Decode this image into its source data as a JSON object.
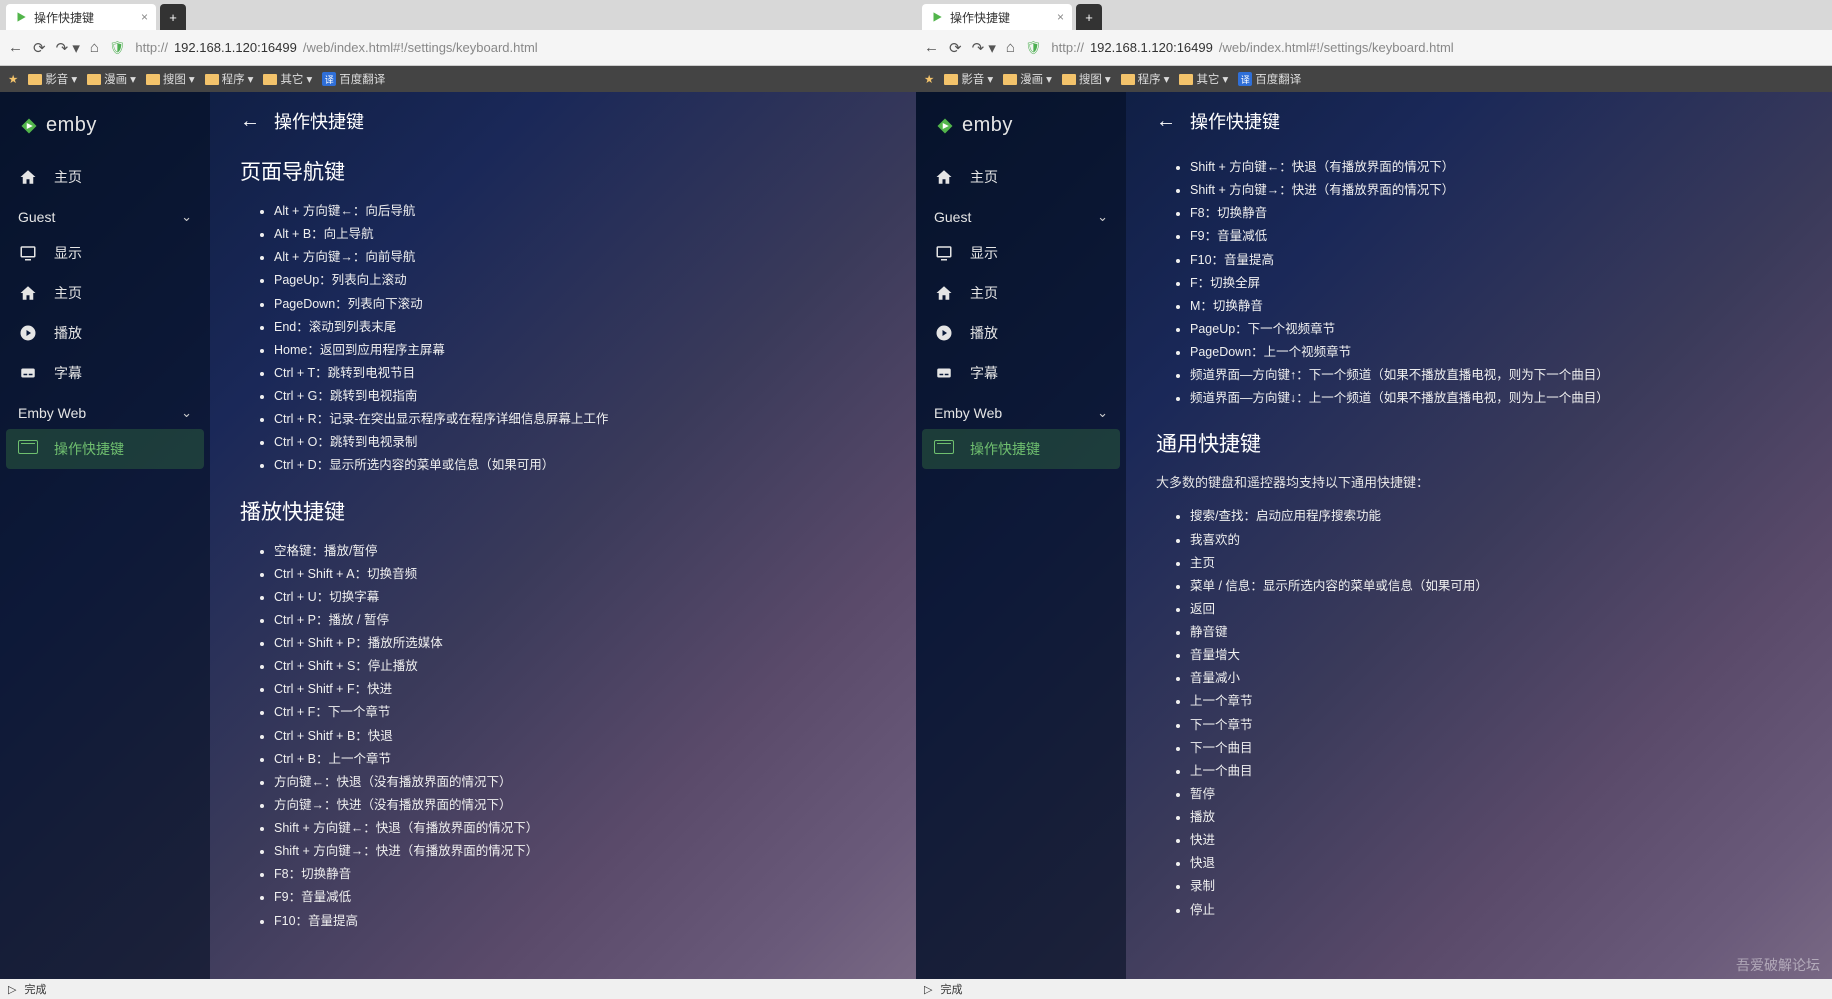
{
  "browser": {
    "tab_title": "操作快捷键",
    "url_prefix": "http://",
    "url_host": "192.168.1.120:16499",
    "url_path": "/web/index.html#!/settings/keyboard.html",
    "status": "完成"
  },
  "bookmarks": [
    "影音",
    "漫画",
    "搜图",
    "程序",
    "其它",
    "百度翻译"
  ],
  "logo_text": "emby",
  "sidebar": {
    "home": "主页",
    "guest": "Guest",
    "display": "显示",
    "home2": "主页",
    "play": "播放",
    "subtitle": "字幕",
    "web": "Emby Web",
    "shortcuts": "操作快捷键"
  },
  "page_title": "操作快捷键",
  "left": {
    "section1": {
      "title": "页面导航键",
      "items": [
        "Alt + 方向键←：向后导航",
        "Alt + B：向上导航",
        "Alt + 方向键→：向前导航",
        "PageUp：列表向上滚动",
        "PageDown：列表向下滚动",
        "End：滚动到列表末尾",
        "Home：返回到应用程序主屏幕",
        "Ctrl + T：跳转到电视节目",
        "Ctrl + G：跳转到电视指南",
        "Ctrl + R：记录-在突出显示程序或在程序详细信息屏幕上工作",
        "Ctrl + O：跳转到电视录制",
        "Ctrl + D：显示所选内容的菜单或信息（如果可用）"
      ]
    },
    "section2": {
      "title": "播放快捷键",
      "items": [
        "空格键：播放/暂停",
        "Ctrl + Shift + A：切换音频",
        "Ctrl + U：切换字幕",
        "Ctrl + P：播放 / 暂停",
        "Ctrl + Shift + P：播放所选媒体",
        "Ctrl + Shift + S：停止播放",
        "Ctrl + Shitf + F：快进",
        "Ctrl + F：下一个章节",
        "Ctrl + Shitf + B：快退",
        "Ctrl + B：上一个章节",
        "方向键←：快退（没有播放界面的情况下）",
        "方向键→：快进（没有播放界面的情况下）",
        "Shift + 方向键←：快退（有播放界面的情况下）",
        "Shift + 方向键→：快进（有播放界面的情况下）",
        "F8：切换静音",
        "F9：音量减低",
        "F10：音量提高"
      ]
    }
  },
  "right": {
    "cont_items": [
      "Shift + 方向键←：快退（有播放界面的情况下）",
      "Shift + 方向键→：快进（有播放界面的情况下）",
      "F8：切换静音",
      "F9：音量减低",
      "F10：音量提高",
      "F：切换全屏",
      "M：切换静音",
      "PageUp：下一个视频章节",
      "PageDown：上一个视频章节",
      "频道界面—方向键↑：下一个频道（如果不播放直播电视，则为下一个曲目）",
      "频道界面—方向键↓：上一个频道（如果不播放直播电视，则为上一个曲目）"
    ],
    "section3": {
      "title": "通用快捷键",
      "desc": "大多数的键盘和遥控器均支持以下通用快捷键：",
      "items": [
        "搜索/查找：启动应用程序搜索功能",
        "我喜欢的",
        "主页",
        "菜单 / 信息：显示所选内容的菜单或信息（如果可用）",
        "返回",
        "静音键",
        "音量增大",
        "音量减小",
        "上一个章节",
        "下一个章节",
        "下一个曲目",
        "上一个曲目",
        "暂停",
        "播放",
        "快进",
        "快退",
        "录制",
        "停止"
      ]
    }
  },
  "watermark": "吾爱破解论坛"
}
